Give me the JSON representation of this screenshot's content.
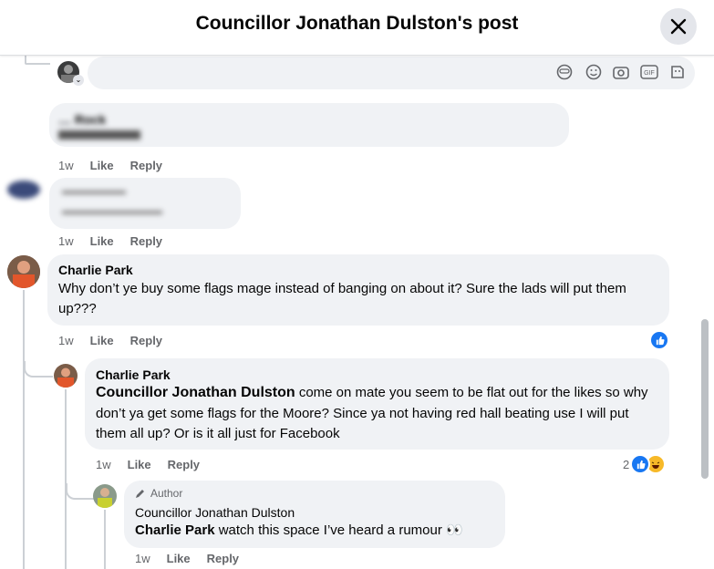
{
  "header": {
    "title": "Councillor Jonathan Dulston's post"
  },
  "composer": {
    "placeholder": ""
  },
  "comments": [
    {
      "name": "Charlie Park",
      "text": "Why don’t ye buy some flags mage instead of banging on about it? Sure the lads will put them up???",
      "time": "1w",
      "like": "Like",
      "reply": "Reply"
    },
    {
      "name": "Charlie Park",
      "mention": "Councillor Jonathan Dulston",
      "text": " come on mate you seem to be flat out for the likes so why don’t ya get some flags for the Moore? Since ya not having red hall beating use I will put them all up? Or is it all just for Facebook",
      "time": "1w",
      "like": "Like",
      "reply": "Reply",
      "reaction_count": "2"
    },
    {
      "badge": "Author",
      "name": "Councillor Jonathan Dulston",
      "mention": "Charlie Park",
      "text": " watch this space I’ve heard a rumour 👀",
      "time": "1w",
      "like": "Like",
      "reply": "Reply"
    }
  ],
  "blurred": [
    {
      "name": "… Rock",
      "time": "1w",
      "like": "Like",
      "reply": "Reply"
    },
    {
      "time": "1w",
      "like": "Like",
      "reply": "Reply"
    }
  ],
  "colors": {
    "like_blue": "#1877f2",
    "bubble": "#f0f2f5",
    "meta": "#65676b"
  }
}
